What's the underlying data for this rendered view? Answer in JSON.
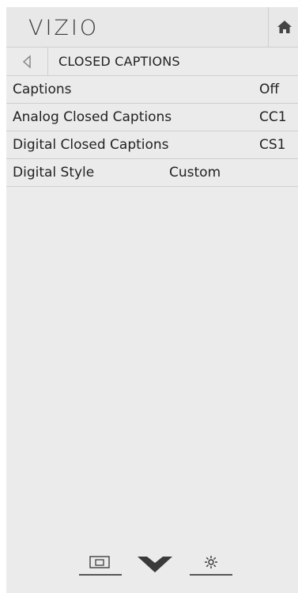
{
  "header": {
    "brand": "VIZIO",
    "home_icon": "home-icon"
  },
  "breadcrumb": {
    "back_icon": "back-triangle-icon",
    "title": "CLOSED CAPTIONS"
  },
  "menu": {
    "items": [
      {
        "label": "Captions",
        "value": "Off"
      },
      {
        "label": "Analog Closed Captions",
        "value": "CC1"
      },
      {
        "label": "Digital Closed Captions",
        "value": "CS1"
      },
      {
        "label": "Digital Style",
        "value": "Custom"
      }
    ]
  },
  "footer": {
    "icons": [
      "picture-input-icon",
      "vizio-v-icon",
      "gear-icon"
    ]
  },
  "colors": {
    "background": "#ebebeb",
    "divider": "#cfcfcf",
    "text": "#222222"
  }
}
